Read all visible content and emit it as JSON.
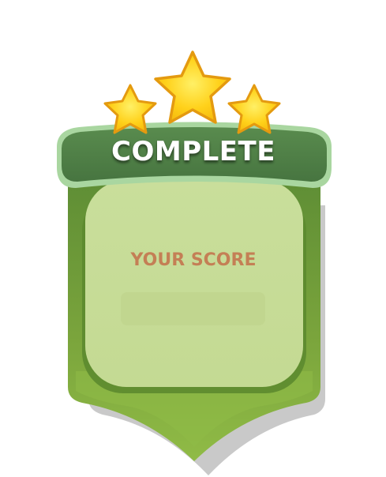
{
  "dialog": {
    "title": "COMPLETE",
    "score_label": "YOUR SCORE",
    "score_value": "",
    "stars_earned": 3,
    "stars_total": 3
  },
  "colors": {
    "banner_dark": "#4e7d46",
    "banner_rim": "#a9d6a0",
    "shield_outer": "#7ba23e",
    "shield_inner_panel": "#c8dc98",
    "shield_shadow": "#c9c9c9",
    "star_fill": "#ffd11a",
    "star_outline": "#e49a10",
    "score_label_color": "#c47f55"
  }
}
